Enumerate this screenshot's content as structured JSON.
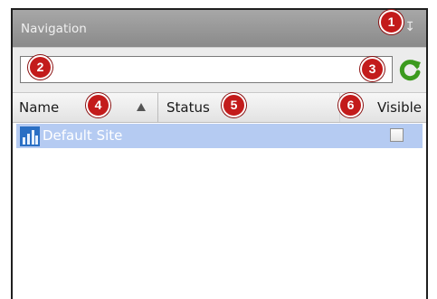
{
  "panel": {
    "title": "Navigation",
    "pin_glyph": "↧",
    "pin_icon": "pin-icon"
  },
  "search": {
    "value": "",
    "placeholder": "",
    "refresh_icon": "refresh-icon"
  },
  "table": {
    "columns": [
      {
        "label": "Name",
        "sort": "ascending"
      },
      {
        "label": "Status"
      },
      {
        "label": "Visible"
      }
    ],
    "rows": [
      {
        "name": "Default Site",
        "status": "",
        "visible": false,
        "selected": true,
        "icon": "site-icon"
      }
    ]
  },
  "callouts": [
    "1",
    "2",
    "3",
    "4",
    "5",
    "6"
  ],
  "colors": {
    "selection": "#b5cbf2",
    "titlebar": "#9a9a9a",
    "callout": "#c31b1b"
  }
}
